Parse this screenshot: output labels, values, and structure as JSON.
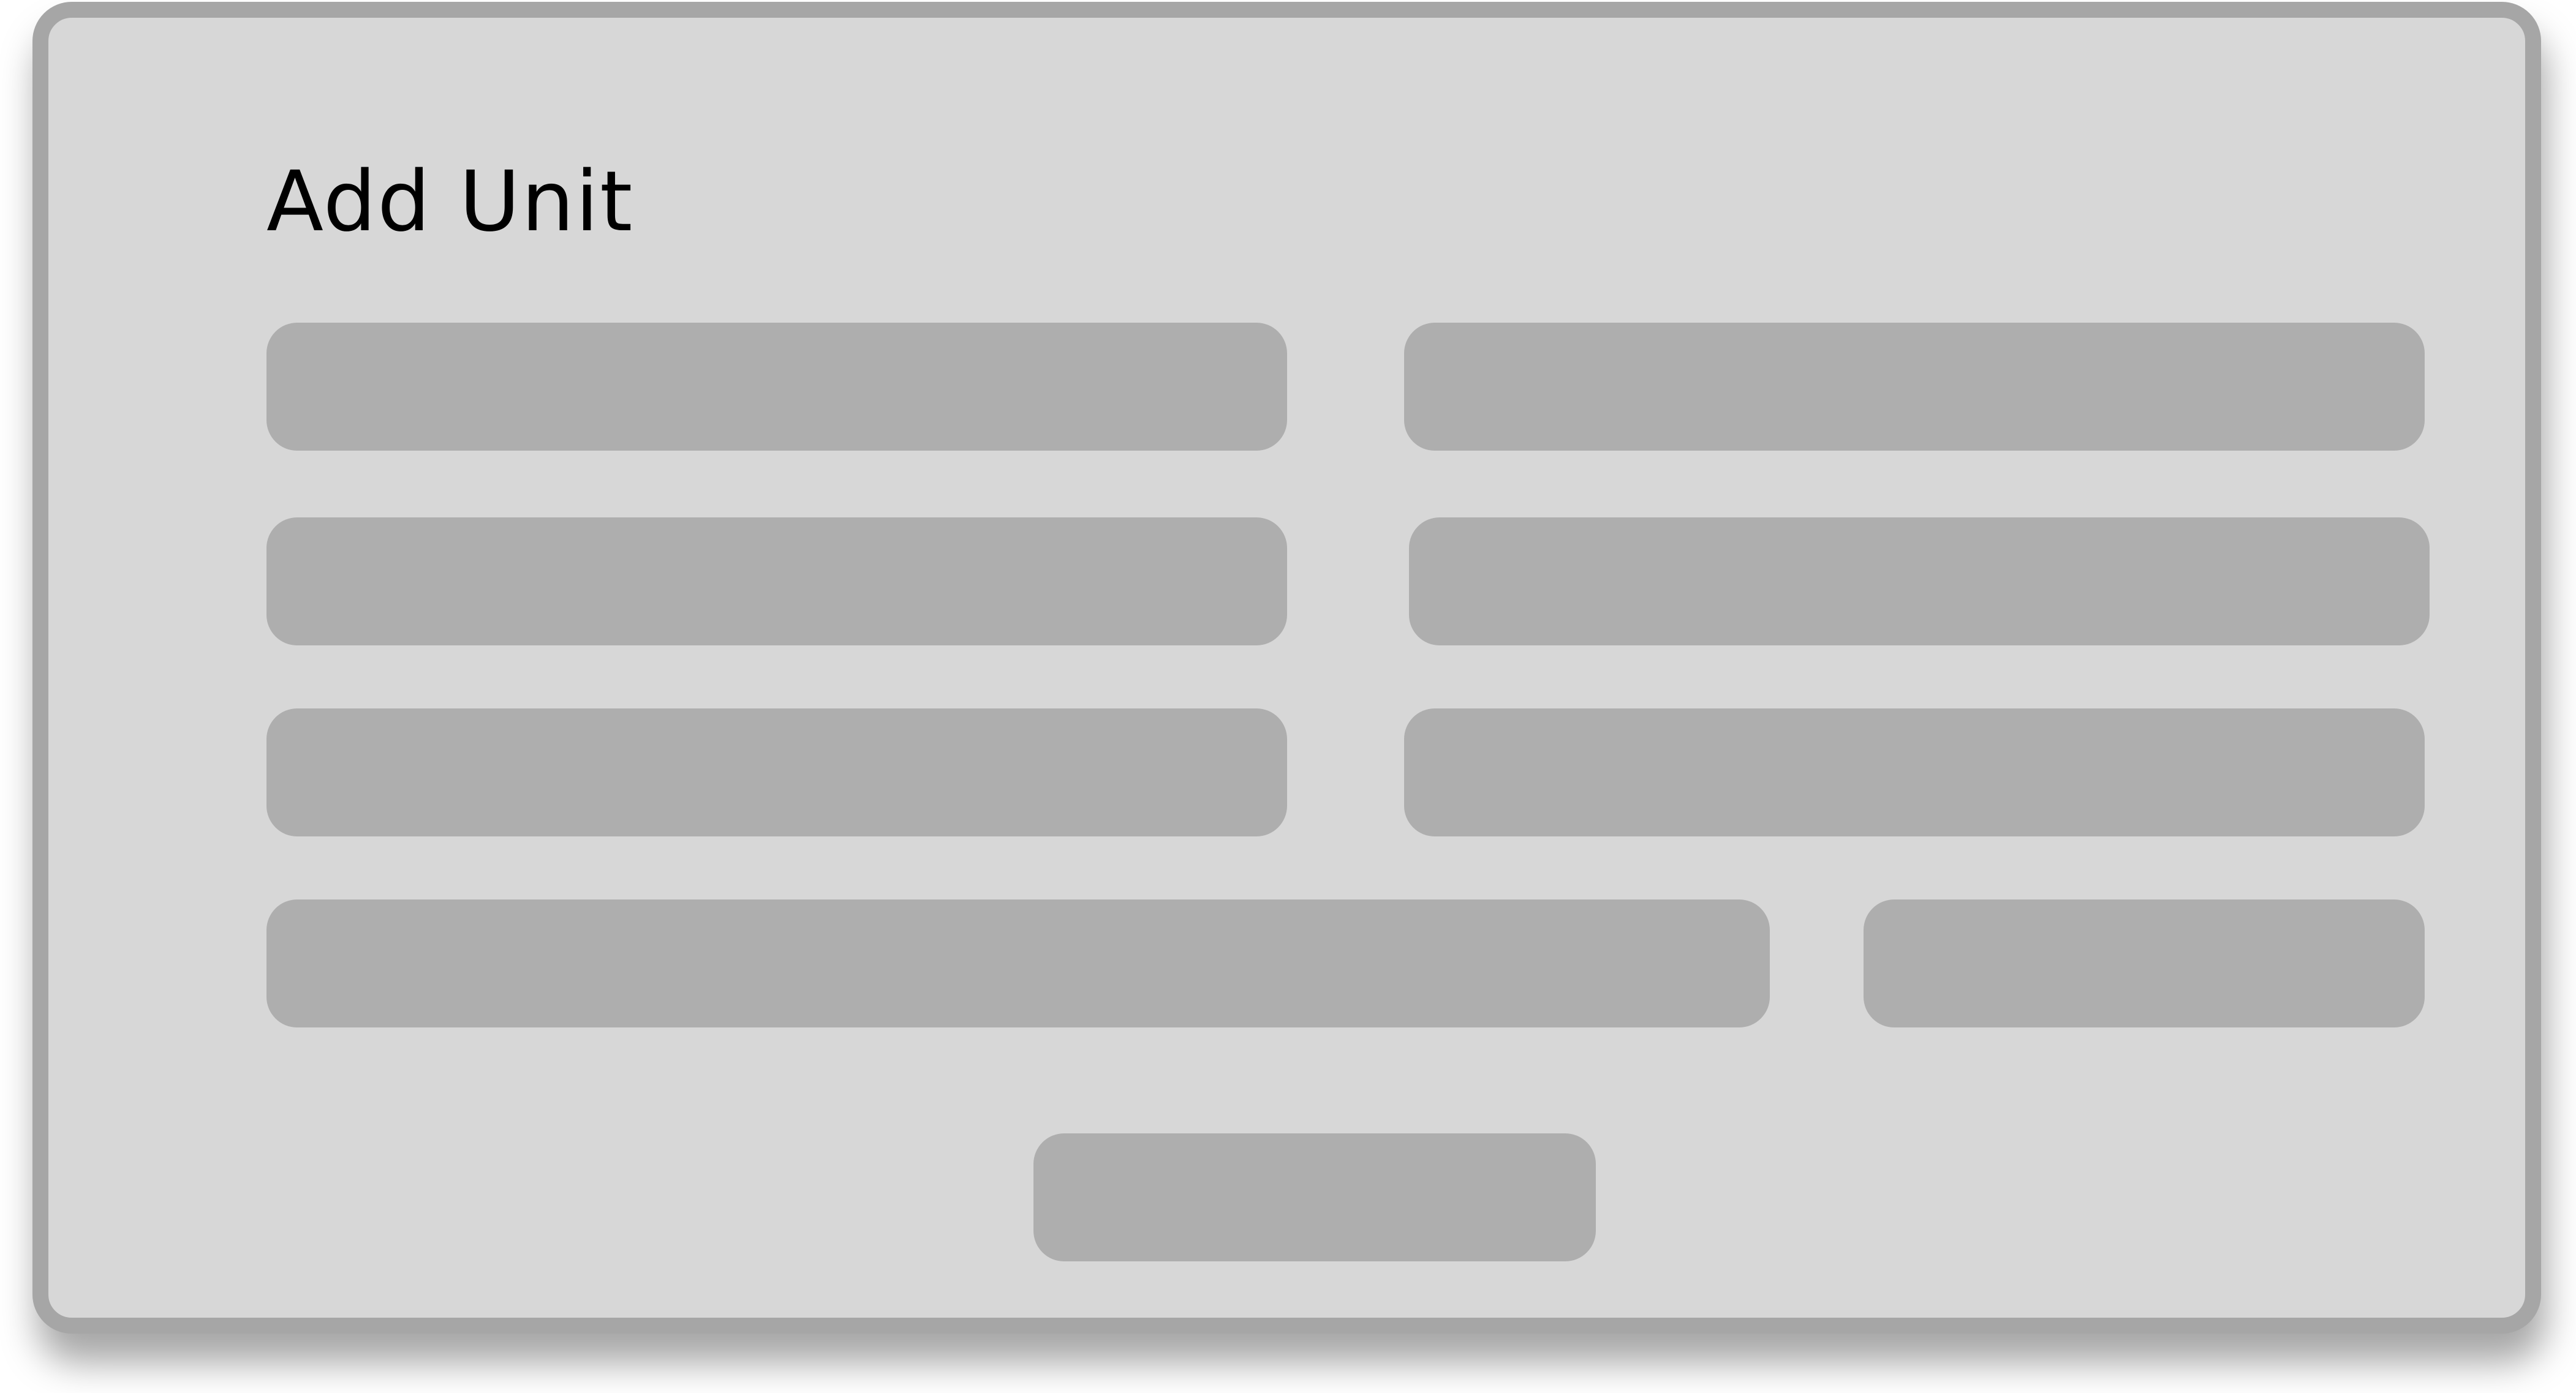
{
  "dialog": {
    "title": "Add Unit",
    "fields": [
      {
        "value": "",
        "placeholder": ""
      },
      {
        "value": "",
        "placeholder": ""
      },
      {
        "value": "",
        "placeholder": ""
      },
      {
        "value": "",
        "placeholder": ""
      },
      {
        "value": "",
        "placeholder": ""
      },
      {
        "value": "",
        "placeholder": ""
      },
      {
        "value": "",
        "placeholder": ""
      },
      {
        "value": "",
        "placeholder": ""
      }
    ],
    "submit_label": ""
  },
  "colors": {
    "panel_background": "#d7d7d7",
    "panel_border": "#a6a6a6",
    "field_fill": "#aeaeae",
    "title_text": "#000000"
  }
}
